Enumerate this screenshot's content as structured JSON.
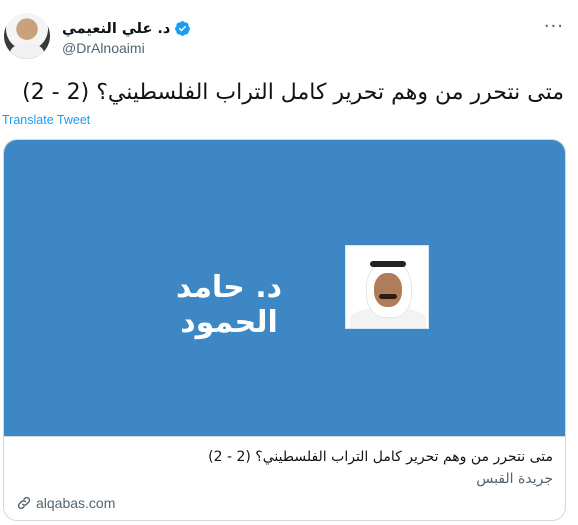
{
  "author": {
    "name": "د. علي النعيمي",
    "handle": "@DrAlnoaimi"
  },
  "menu_icon": "more-dots-icon",
  "tweet": {
    "text": "متى نتحرر من وهم تحرير كامل التراب الفلسطيني؟ (2 - 2)",
    "translate_label": "Translate Tweet"
  },
  "card": {
    "image_caption": "د. حامد الحمود",
    "title": "متى نتحرر من وهم تحرير كامل التراب الفلسطيني؟ (2 - 2)",
    "source": "جريدة القبس",
    "domain": "alqabas.com"
  },
  "colors": {
    "accent": "#1d9bf0",
    "card_bg": "#3e87c5"
  }
}
